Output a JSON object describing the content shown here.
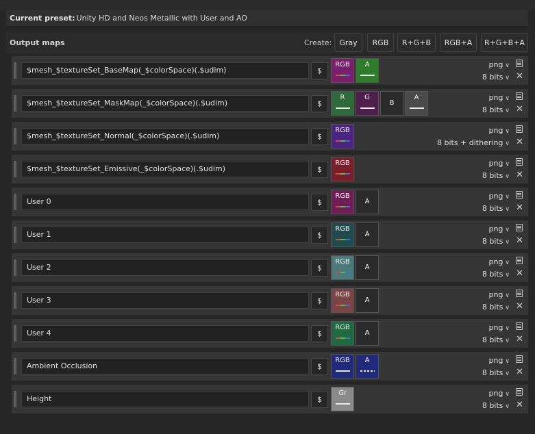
{
  "preset": {
    "label": "Current preset:",
    "value": "Unity HD and Neos Metallic with User and AO"
  },
  "output_maps": {
    "title": "Output maps",
    "create_label": "Create:",
    "create_buttons": [
      "Gray",
      "RGB",
      "R+G+B",
      "RGB+A",
      "R+G+B+A"
    ]
  },
  "rows": [
    {
      "name": "$mesh_$textureSet_BaseMap(_$colorSpace)(.$udim)",
      "dollar": "$",
      "channels": [
        {
          "label": "RGB",
          "color": "#7a1f6c",
          "bar": "rgb"
        },
        {
          "label": "A",
          "color": "#2f7d2a",
          "bar": "white"
        }
      ],
      "format": "png",
      "bits": "8 bits"
    },
    {
      "name": "$mesh_$textureSet_MaskMap(_$colorSpace)(.$udim)",
      "dollar": "$",
      "channels": [
        {
          "label": "R",
          "color": "#2f6a3a",
          "bar": "white"
        },
        {
          "label": "G",
          "color": "#4e1f4a",
          "bar": "white"
        },
        {
          "label": "B",
          "color": "#2a2a2a",
          "bar": "none"
        },
        {
          "label": "A",
          "color": "#4a4a4a",
          "bar": "white"
        }
      ],
      "format": "png",
      "bits": "8 bits"
    },
    {
      "name": "$mesh_$textureSet_Normal(_$colorSpace)(.$udim)",
      "dollar": "$",
      "channels": [
        {
          "label": "RGB",
          "color": "#4b2480",
          "bar": "rgb"
        }
      ],
      "format": "png",
      "bits": "8 bits + dithering"
    },
    {
      "name": "$mesh_$textureSet_Emissive(_$colorSpace)(.$udim)",
      "dollar": "$",
      "channels": [
        {
          "label": "RGB",
          "color": "#7a1f2a",
          "bar": "rgb"
        }
      ],
      "format": "png",
      "bits": "8 bits"
    },
    {
      "name": "User 0",
      "dollar": "$",
      "channels": [
        {
          "label": "RGB",
          "color": "#6e1e55",
          "bar": "rgb"
        },
        {
          "label": "A",
          "color": "#2a2a2a",
          "bar": "none"
        }
      ],
      "format": "png",
      "bits": "8 bits"
    },
    {
      "name": "User 1",
      "dollar": "$",
      "channels": [
        {
          "label": "RGB",
          "color": "#1f4a4e",
          "bar": "rgb"
        },
        {
          "label": "A",
          "color": "#2a2a2a",
          "bar": "none"
        }
      ],
      "format": "png",
      "bits": "8 bits"
    },
    {
      "name": "User 2",
      "dollar": "$",
      "channels": [
        {
          "label": "RGB",
          "color": "#4a7a7a",
          "bar": "rgb"
        },
        {
          "label": "A",
          "color": "#2a2a2a",
          "bar": "none"
        }
      ],
      "format": "png",
      "bits": "8 bits"
    },
    {
      "name": "User 3",
      "dollar": "$",
      "channels": [
        {
          "label": "RGB",
          "color": "#7a4444",
          "bar": "rgb"
        },
        {
          "label": "A",
          "color": "#2a2a2a",
          "bar": "none"
        }
      ],
      "format": "png",
      "bits": "8 bits"
    },
    {
      "name": "User 4",
      "dollar": "$",
      "channels": [
        {
          "label": "RGB",
          "color": "#1f6a40",
          "bar": "rgb"
        },
        {
          "label": "A",
          "color": "#2a2a2a",
          "bar": "none"
        }
      ],
      "format": "png",
      "bits": "8 bits"
    },
    {
      "name": "Ambient Occlusion",
      "dollar": "$",
      "channels": [
        {
          "label": "RGB",
          "color": "#1f2a7a",
          "bar": "white"
        },
        {
          "label": "A",
          "color": "#1f2a7a",
          "bar": "dashed"
        }
      ],
      "format": "png",
      "bits": "8 bits"
    },
    {
      "name": "Height",
      "dollar": "$",
      "channels": [
        {
          "label": "Gr",
          "color": "#8a8a8a",
          "bar": "white"
        }
      ],
      "format": "png",
      "bits": "8 bits"
    }
  ]
}
